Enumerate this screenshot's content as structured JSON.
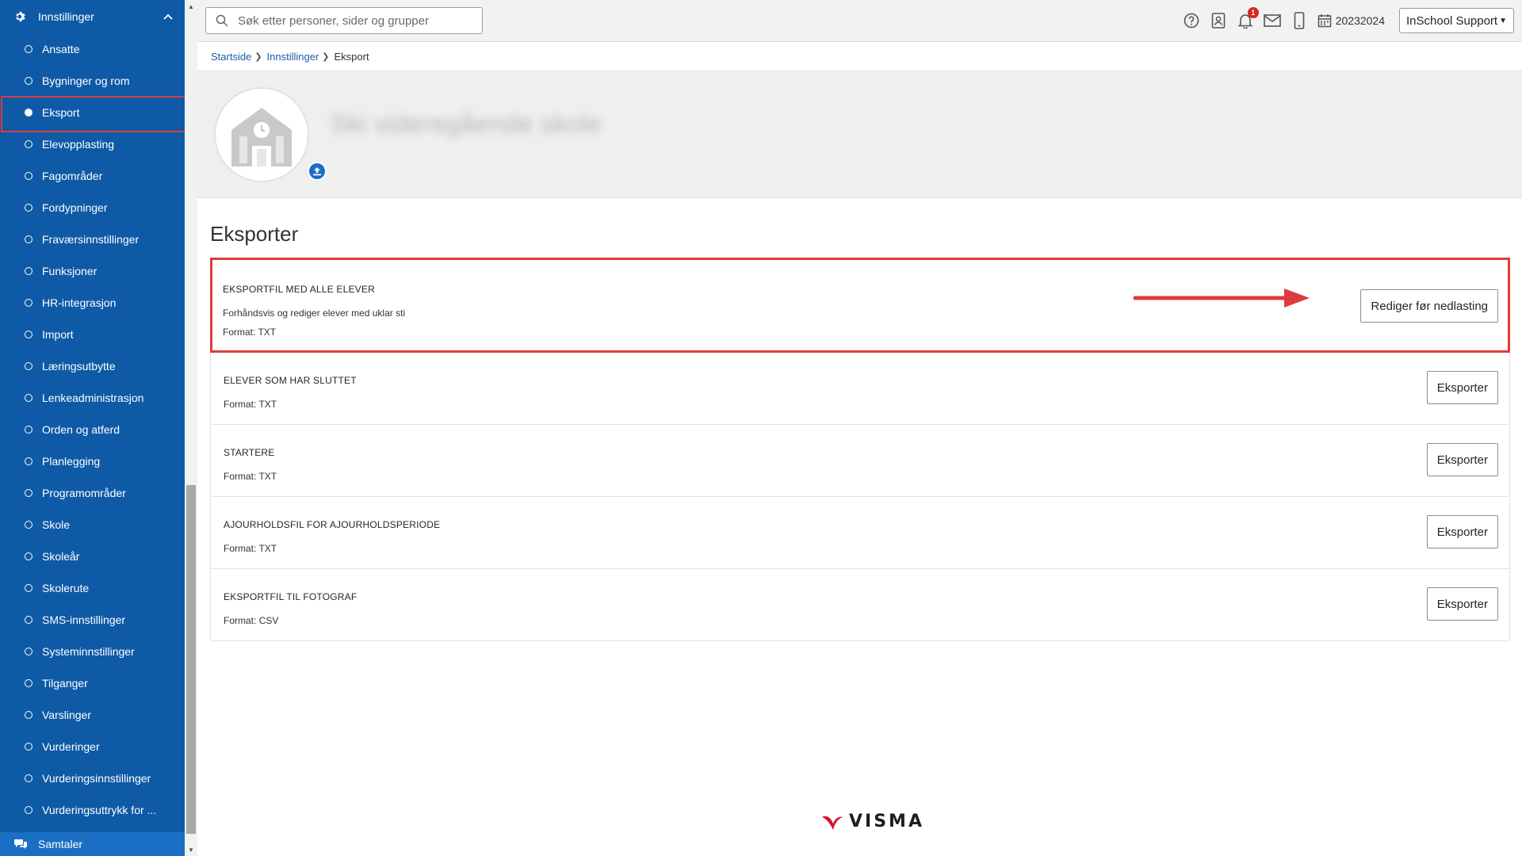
{
  "sidebar": {
    "header_label": "Innstillinger",
    "items": [
      {
        "label": "Ansatte"
      },
      {
        "label": "Bygninger og rom"
      },
      {
        "label": "Eksport"
      },
      {
        "label": "Elevopplasting"
      },
      {
        "label": "Fagområder"
      },
      {
        "label": "Fordypninger"
      },
      {
        "label": "Fraværsinnstillinger"
      },
      {
        "label": "Funksjoner"
      },
      {
        "label": "HR-integrasjon"
      },
      {
        "label": "Import"
      },
      {
        "label": "Læringsutbytte"
      },
      {
        "label": "Lenkeadministrasjon"
      },
      {
        "label": "Orden og atferd"
      },
      {
        "label": "Planlegging"
      },
      {
        "label": "Programområder"
      },
      {
        "label": "Skole"
      },
      {
        "label": "Skoleår"
      },
      {
        "label": "Skolerute"
      },
      {
        "label": "SMS-innstillinger"
      },
      {
        "label": "Systeminnstillinger"
      },
      {
        "label": "Tilganger"
      },
      {
        "label": "Varslinger"
      },
      {
        "label": "Vurderinger"
      },
      {
        "label": "Vurderingsinnstillinger"
      },
      {
        "label": "Vurderingsuttrykk for ..."
      }
    ],
    "active_item": "Eksport",
    "bottom_label": "Samtaler"
  },
  "topbar": {
    "search_placeholder": "Søk etter personer, sider og grupper",
    "notification_count": "1",
    "school_year": "20232024",
    "user_label": "InSchool Support"
  },
  "breadcrumb": {
    "items": [
      "Startside",
      "Innstillinger"
    ],
    "current": "Eksport"
  },
  "banner": {
    "school_name": "Ski videregående skole"
  },
  "main": {
    "section_title": "Eksporter",
    "exports": [
      {
        "title": "EKSPORTFIL MED ALLE ELEVER",
        "description": "Forhåndsvis og rediger elever med uklar sti",
        "format": "Format: TXT",
        "button": "Rediger før nedlasting"
      },
      {
        "title": "ELEVER SOM HAR SLUTTET",
        "format": "Format: TXT",
        "button": "Eksporter"
      },
      {
        "title": "STARTERE",
        "format": "Format: TXT",
        "button": "Eksporter"
      },
      {
        "title": "AJOURHOLDSFIL FOR AJOURHOLDSPERIODE",
        "format": "Format: TXT",
        "button": "Eksporter"
      },
      {
        "title": "EKSPORTFIL TIL FOTOGRAF",
        "format": "Format: CSV",
        "button": "Eksporter"
      }
    ]
  },
  "footer": {
    "logo_text": "VISMA"
  },
  "colors": {
    "sidebar_bg": "#0e5aa7",
    "highlight_red": "#dc3c3c",
    "link_blue": "#1c5fa8",
    "badge_red": "#d9261c"
  }
}
